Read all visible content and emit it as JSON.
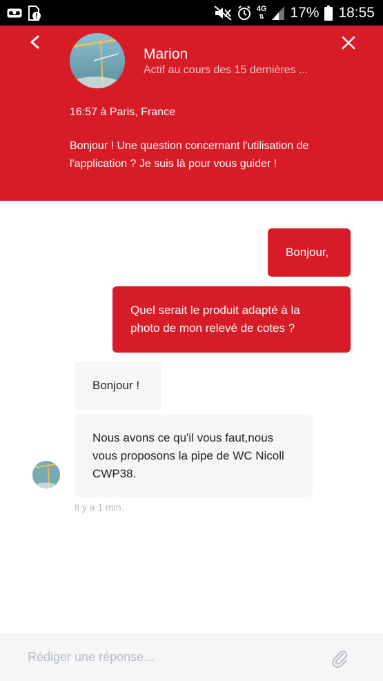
{
  "status_bar": {
    "network_label": "4G",
    "battery_percent": "17%",
    "time": "18:55",
    "icons": [
      "voicemail-icon",
      "sim-alert-icon",
      "mute-icon",
      "alarm-icon",
      "signal-icon",
      "battery-icon"
    ]
  },
  "header": {
    "agent_name": "Marion",
    "agent_status": "Actif au cours des 15 dernières ...",
    "local_time": "16:57 à Paris, France",
    "greeting": "Bonjour ! Une question concernant l'utilisation de l'application ? Je suis là pour vous guider !",
    "background_color": "#d71b27"
  },
  "conversation": {
    "outgoing": [
      {
        "text": "Bonjour,"
      },
      {
        "text": "Quel serait le produit adapté à la photo de mon relevé de cotes ?"
      }
    ],
    "incoming": [
      {
        "text": "Bonjour !"
      },
      {
        "text": "Nous avons ce qu'il vous faut,nous vous proposons la pipe de WC Nicoll CWP38."
      }
    ],
    "timestamp": "Il y a 1 min."
  },
  "composer": {
    "placeholder": "Rédiger une réponse...",
    "value": ""
  },
  "colors": {
    "accent": "#d71b27",
    "incoming_bubble": "#f4f6f8",
    "composer_bg": "#f4f6f8"
  }
}
